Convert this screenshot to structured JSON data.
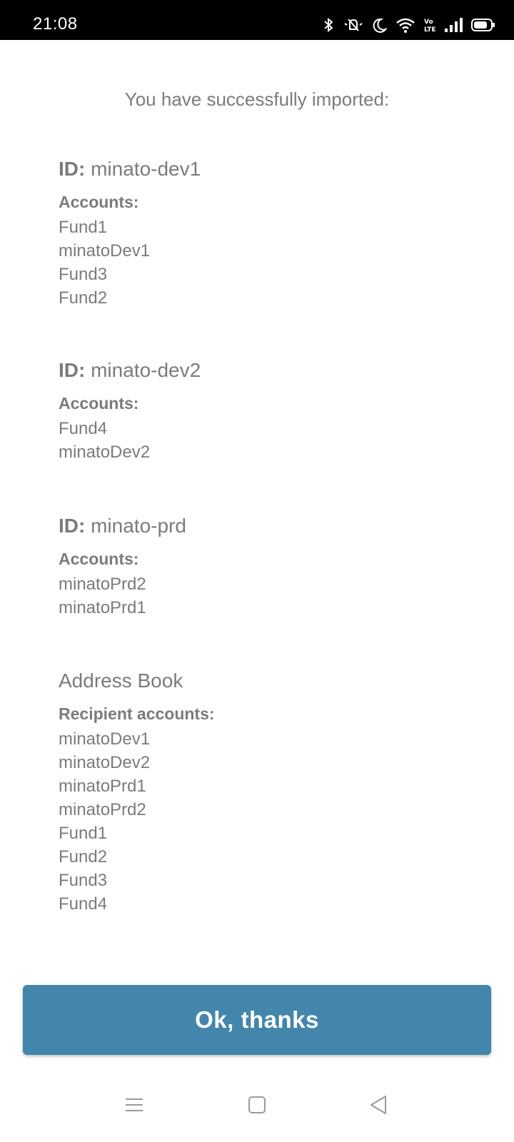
{
  "status_bar": {
    "time": "21:08"
  },
  "intro_text": "You have successfully imported:",
  "sections": [
    {
      "id_label": "ID:",
      "id_value": "minato-dev1",
      "accounts_label": "Accounts:",
      "accounts": [
        "Fund1",
        "minatoDev1",
        "Fund3",
        "Fund2"
      ]
    },
    {
      "id_label": "ID:",
      "id_value": "minato-dev2",
      "accounts_label": "Accounts:",
      "accounts": [
        "Fund4",
        "minatoDev2"
      ]
    },
    {
      "id_label": "ID:",
      "id_value": "minato-prd",
      "accounts_label": "Accounts:",
      "accounts": [
        "minatoPrd2",
        "minatoPrd1"
      ]
    }
  ],
  "address_book": {
    "title": "Address Book",
    "recipients_label": "Recipient accounts:",
    "recipients": [
      "minatoDev1",
      "minatoDev2",
      "minatoPrd1",
      "minatoPrd2",
      "Fund1",
      "Fund2",
      "Fund3",
      "Fund4"
    ]
  },
  "ok_button_label": "Ok, thanks",
  "colors": {
    "button": "#4486ab",
    "text": "#7b7b7b"
  }
}
